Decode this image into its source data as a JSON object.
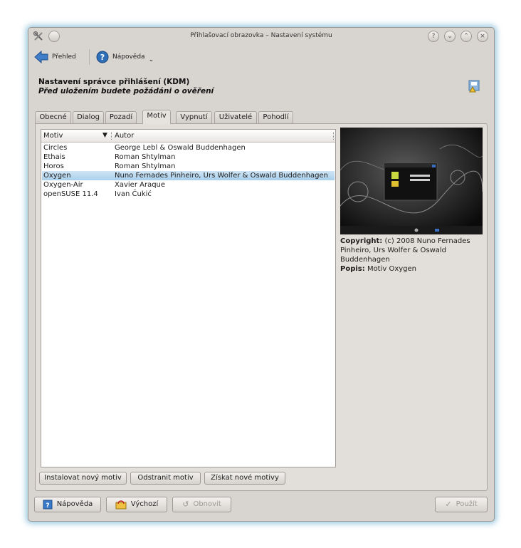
{
  "window": {
    "title": "Přihlašovací obrazovka – Nastavení systému"
  },
  "toolbar": {
    "overview_label": "Přehled",
    "help_label": "Nápověda"
  },
  "header": {
    "title": "Nastavení správce přihlášení (KDM)",
    "subtitle": "Před uložením budete požádáni o ověření"
  },
  "tabs": [
    "Obecné",
    "Dialog",
    "Pozadí",
    "Motiv",
    "Vypnutí",
    "Uživatelé",
    "Pohodlí"
  ],
  "active_tab": "Motiv",
  "theme_list": {
    "columns": [
      "Motiv",
      "Autor"
    ],
    "rows": [
      {
        "name": "Circles",
        "author": "George Lebl & Oswald Buddenhagen"
      },
      {
        "name": "Ethais",
        "author": "Roman Shtylman"
      },
      {
        "name": "Horos",
        "author": "Roman Shtylman"
      },
      {
        "name": "Oxygen",
        "author": "Nuno Fernades Pinheiro, Urs Wolfer & Oswald Buddenhagen"
      },
      {
        "name": "Oxygen-Air",
        "author": "Xavier Araque"
      },
      {
        "name": "openSUSE 11.4",
        "author": "Ivan Čukić"
      }
    ],
    "selected": "Oxygen"
  },
  "details": {
    "copyright_label": "Copyright:",
    "copyright_text": "(c) 2008 Nuno Fernades Pinheiro, Urs Wolfer & Oswald Buddenhagen",
    "description_label": "Popis:",
    "description_text": "Motiv Oxygen"
  },
  "panel_buttons": {
    "install": "Instalovat nový motiv",
    "remove": "Odstranit motiv",
    "get_new": "Získat nové motivy"
  },
  "bottom_buttons": {
    "help": "Nápověda",
    "defaults": "Výchozí",
    "reset": "Obnovit",
    "apply": "Použít"
  },
  "colors": {
    "selection": "#a9cfec",
    "window_bg": "#d8d4cf",
    "glow": "#50a0c8"
  }
}
